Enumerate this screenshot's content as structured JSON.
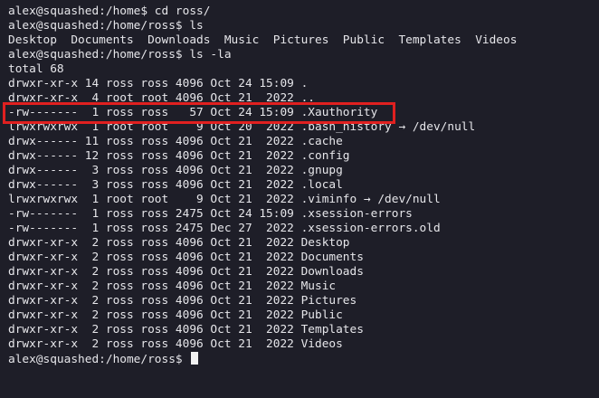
{
  "terminal": {
    "lines": [
      "alex@squashed:/home$ cd ross/",
      "alex@squashed:/home/ross$ ls",
      "Desktop  Documents  Downloads  Music  Pictures  Public  Templates  Videos",
      "alex@squashed:/home/ross$ ls -la",
      "total 68",
      "drwxr-xr-x 14 ross ross 4096 Oct 24 15:09 .",
      "drwxr-xr-x  4 root root 4096 Oct 21  2022 ..",
      "-rw-------  1 ross ross   57 Oct 24 15:09 .Xauthority",
      "lrwxrwxrwx  1 root root    9 Oct 20  2022 .bash_history → /dev/null",
      "drwx------ 11 ross ross 4096 Oct 21  2022 .cache",
      "drwx------ 12 ross ross 4096 Oct 21  2022 .config",
      "drwx------  3 ross ross 4096 Oct 21  2022 .gnupg",
      "drwx------  3 ross ross 4096 Oct 21  2022 .local",
      "lrwxrwxrwx  1 root root    9 Oct 21  2022 .viminfo → /dev/null",
      "-rw-------  1 ross ross 2475 Oct 24 15:09 .xsession-errors",
      "-rw-------  1 ross ross 2475 Dec 27  2022 .xsession-errors.old",
      "drwxr-xr-x  2 ross ross 4096 Oct 21  2022 Desktop",
      "drwxr-xr-x  2 ross ross 4096 Oct 21  2022 Documents",
      "drwxr-xr-x  2 ross ross 4096 Oct 21  2022 Downloads",
      "drwxr-xr-x  2 ross ross 4096 Oct 21  2022 Music",
      "drwxr-xr-x  2 ross ross 4096 Oct 21  2022 Pictures",
      "drwxr-xr-x  2 ross ross 4096 Oct 21  2022 Public",
      "drwxr-xr-x  2 ross ross 4096 Oct 21  2022 Templates",
      "drwxr-xr-x  2 ross ross 4096 Oct 21  2022 Videos"
    ],
    "prompt": "alex@squashed:/home/ross$ "
  },
  "colors": {
    "background": "#1e1e28",
    "text": "#e6e6ea",
    "highlight": "#e02020"
  }
}
